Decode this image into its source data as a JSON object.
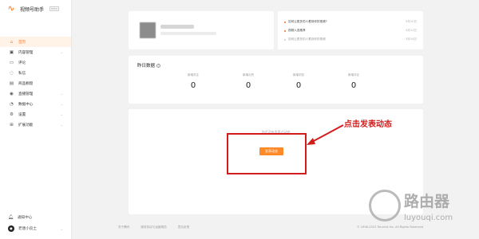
{
  "app": {
    "name": "视频号助手",
    "badge": "beta"
  },
  "sidebar": {
    "items": [
      {
        "label": "首页",
        "icon": "home-icon",
        "active": true,
        "chevron": false
      },
      {
        "label": "内容管理",
        "icon": "content-icon",
        "active": false,
        "chevron": true
      },
      {
        "label": "评论",
        "icon": "comment-icon",
        "active": false,
        "chevron": false
      },
      {
        "label": "私信",
        "icon": "message-icon",
        "active": false,
        "chevron": false
      },
      {
        "label": "商品橱窗",
        "icon": "shop-icon",
        "active": false,
        "chevron": false
      },
      {
        "label": "直播管理",
        "icon": "live-icon",
        "active": false,
        "chevron": true
      },
      {
        "label": "数据中心",
        "icon": "data-icon",
        "active": false,
        "chevron": true
      },
      {
        "label": "设置",
        "icon": "settings-icon",
        "active": false,
        "chevron": true
      },
      {
        "label": "扩展功能",
        "icon": "extension-icon",
        "active": false,
        "chevron": true
      }
    ],
    "notify_label": "通知中心",
    "user_label": "老唐小良土"
  },
  "notices": [
    {
      "text": "如何让更多的人看到你的视频?",
      "date": "5月10日",
      "read": false
    },
    {
      "text": "视频入选推荐",
      "date": "4月11日",
      "read": false
    },
    {
      "text": "如何让更多的人看到你的视频",
      "date": "3月14日",
      "read": true
    }
  ],
  "stats": {
    "title": "昨日数据",
    "items": [
      {
        "label": "新增关注",
        "value": "0"
      },
      {
        "label": "新增点赞",
        "value": "0"
      },
      {
        "label": "新增浏览",
        "value": "0"
      },
      {
        "label": "新增评论",
        "value": "0"
      }
    ]
  },
  "post": {
    "hint": "你还没有发表过动态",
    "button_label": "发表动态"
  },
  "annotation": {
    "text": "点击发表动态",
    "color": "#d21c1c"
  },
  "footer": {
    "links": [
      "关于腾讯",
      "服务协议与运营规范",
      "意见反馈"
    ],
    "copyright": "© 1998-2022 Tencent Inc. All Rights Reserved"
  },
  "watermark": {
    "title": "路由器",
    "url": "luyouqi.com"
  },
  "colors": {
    "accent": "#ff7a2f",
    "button": "#ff8a2a",
    "annotation": "#d21c1c"
  }
}
